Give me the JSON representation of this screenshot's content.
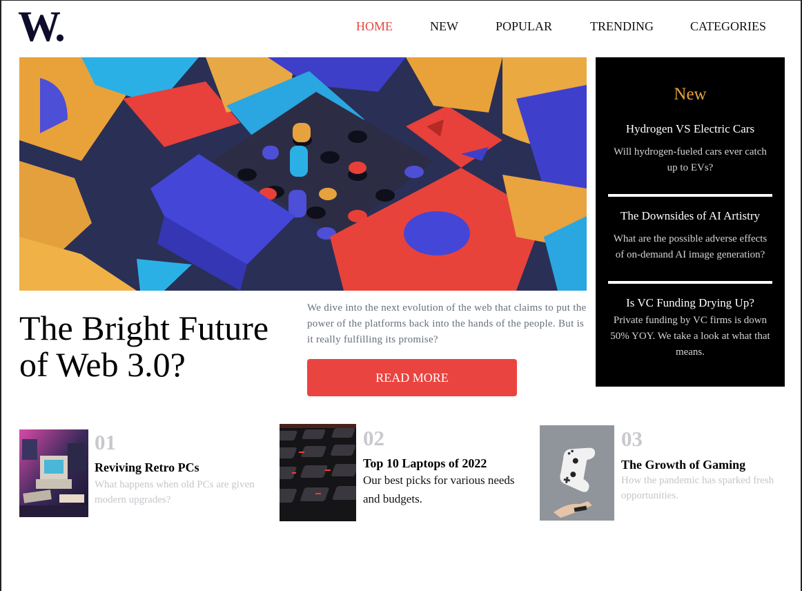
{
  "brand": {
    "logo_text": "W."
  },
  "nav": {
    "items": [
      "HOME",
      "NEW",
      "POPULAR",
      "TRENDING",
      "CATEGORIES"
    ],
    "active": "HOME"
  },
  "featured": {
    "title": "The Bright Future of Web 3.0?",
    "summary": "We dive into the next evolution of the web that claims to put the power of the platforms back into the hands of the people. But is it really fulfilling its promise?",
    "cta": "READ MORE",
    "image": "abstract-3d-blocks-image"
  },
  "sidebar": {
    "heading": "New",
    "items": [
      {
        "title": "Hydrogen VS Electric Cars",
        "desc": "Will hydrogen-fueled cars ever catch up to EVs?"
      },
      {
        "title": "The Downsides of AI Artistry",
        "desc": "What are the possible adverse effects of on-demand AI image generation?"
      },
      {
        "title": "Is VC Funding Drying Up?",
        "desc": "Private funding by VC firms is down 50% YOY. We take a look at what that means."
      }
    ]
  },
  "cards": [
    {
      "num": "01",
      "title": "Reviving Retro PCs",
      "desc": "What happens when old PCs are given modern upgrades?",
      "image": "retro-pc-image"
    },
    {
      "num": "02",
      "title": "Top 10 Laptops of 2022",
      "desc": "Our best picks for various needs and budgets.",
      "image": "keyboard-image"
    },
    {
      "num": "03",
      "title": "The Growth of Gaming",
      "desc": "How the pandemic has sparked fresh opportunities.",
      "image": "game-controller-image"
    }
  ],
  "colors": {
    "accent": "#ea4440",
    "sidebar_bg": "#000000",
    "sidebar_heading": "#e9a33f",
    "muted": "#c6c6cc"
  }
}
